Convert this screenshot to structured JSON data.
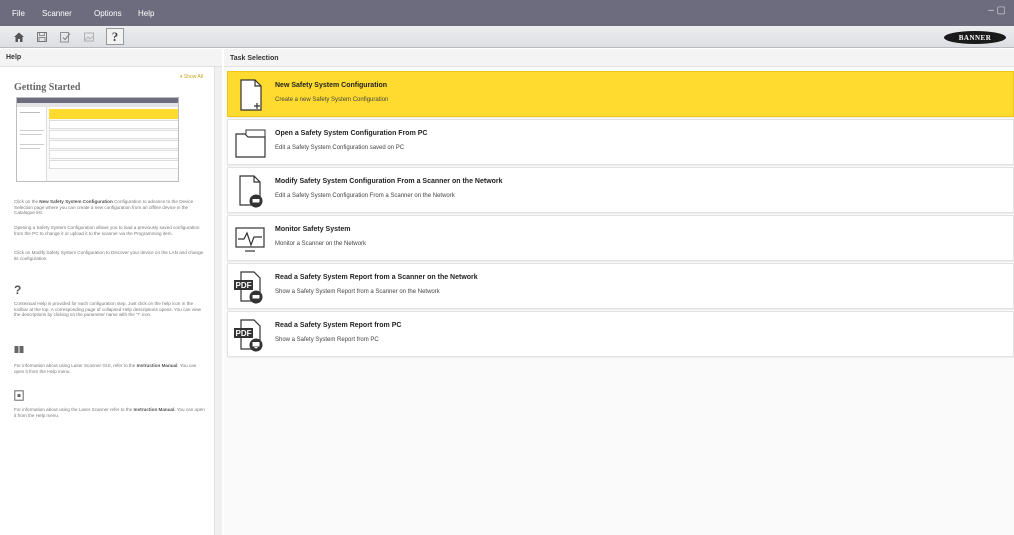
{
  "menu": {
    "file": "File",
    "scanner": "Scanner",
    "options": "Options",
    "help": "Help",
    "winctl": "– ▢"
  },
  "toolbar": {
    "icons": [
      "home-icon",
      "save-icon",
      "check-icon",
      "image-icon",
      "help-icon"
    ],
    "help_glyph": "?"
  },
  "brand": {
    "logo": "BANNER"
  },
  "help_panel": {
    "header": "Help",
    "show_all": "▾ Show All",
    "title": "Getting Started",
    "paragraphs": [
      [
        "Click on the ",
        "New Safety System Configuration",
        " Configuration to advance to the Device Selection page where you can create a new configuration from an offline device in the Catalogue list."
      ],
      [
        "Opening a Safety System Configuration allows you to load a previously saved configuration from the PC to change it or upload it to the scanner via the Programming item.",
        "",
        ""
      ],
      [
        "Click on Modify Safety System Configuration to Discover your device on the LAN and change its configuration.",
        "",
        ""
      ]
    ],
    "question_mark": "?",
    "contextual": "Contextual Help is provided for each configuration step. Just click on the help icon in the toolbar at the top. A corresponding page of collapsed Help descriptions opens. You can view the descriptions by clicking on the parameter name with the '?' icon.",
    "manual1_pre": "For information about using Laser Scanner GUI, refer to the ",
    "manual1_bold": "Instruction Manual",
    "manual1_post": ". You can open it from the Help menu.",
    "manual2_pre": "For information about using the Laser Scanner refer to the ",
    "manual2_bold": "Instruction Manual",
    "manual2_post": ". You can open it from the Help menu."
  },
  "task_selection": {
    "header": "Task Selection",
    "tasks": [
      {
        "title": "New Safety System Configuration",
        "subtitle": "Create a new Safety System Configuration",
        "icon": "new-file-icon",
        "selected": true
      },
      {
        "title": "Open a Safety System Configuration From PC",
        "subtitle": "Edit a Safety System Configuration saved on PC",
        "icon": "folder-icon",
        "selected": false
      },
      {
        "title": "Modify Safety System Configuration From a Scanner on the Network",
        "subtitle": "Edit a Safety System Configuration From a Scanner on the Network",
        "icon": "scanner-file-icon",
        "selected": false
      },
      {
        "title": "Monitor Safety System",
        "subtitle": "Monitor a Scanner on the Network",
        "icon": "monitor-pulse-icon",
        "selected": false
      },
      {
        "title": "Read a Safety System Report from a Scanner on the Network",
        "subtitle": "Show a Safety System Report from a Scanner on the Network",
        "icon": "pdf-scanner-icon",
        "selected": false
      },
      {
        "title": "Read a Safety System Report from PC",
        "subtitle": "Show a Safety System Report from PC",
        "icon": "pdf-pc-icon",
        "selected": false
      }
    ]
  },
  "colors": {
    "accent": "#fedb2e",
    "menubar": "#6c6c7e"
  }
}
